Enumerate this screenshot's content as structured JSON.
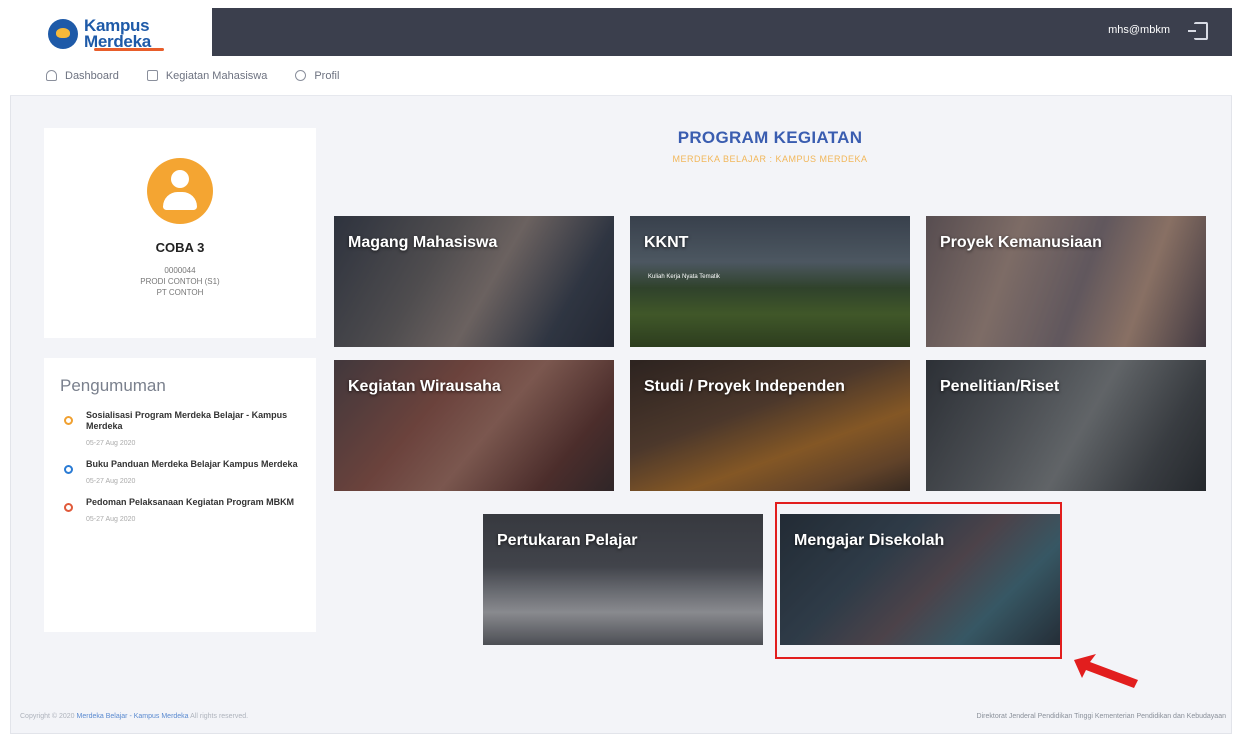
{
  "header": {
    "logo_line1": "Kampus",
    "logo_line2": "Merdeka",
    "user_email": "mhs@mbkm",
    "logout_icon": "logout-icon"
  },
  "nav": {
    "items": [
      {
        "label": "Dashboard",
        "icon": "home-icon"
      },
      {
        "label": "Kegiatan Mahasiswa",
        "icon": "document-icon"
      },
      {
        "label": "Profil",
        "icon": "user-icon"
      }
    ]
  },
  "profile": {
    "name": "COBA 3",
    "nim": "0000044",
    "prodi": "PRODI CONTOH (S1)",
    "pt": "PT CONTOH"
  },
  "announcements": {
    "title": "Pengumuman",
    "items": [
      {
        "title": "Sosialisasi Program Merdeka Belajar - Kampus Merdeka",
        "date": "05-27 Aug 2020"
      },
      {
        "title": "Buku Panduan Merdeka Belajar Kampus Merdeka",
        "date": "05-27 Aug 2020"
      },
      {
        "title": "Pedoman Pelaksanaan Kegiatan Program MBKM",
        "date": "05-27 Aug 2020"
      }
    ]
  },
  "main": {
    "title": "PROGRAM KEGIATAN",
    "subtitle": "MERDEKA BELAJAR : KAMPUS MERDEKA",
    "tiles": [
      {
        "label": "Magang Mahasiswa"
      },
      {
        "label": "KKNT",
        "sub": "Kuliah Kerja Nyata Tematik"
      },
      {
        "label": "Proyek Kemanusiaan"
      },
      {
        "label": "Kegiatan Wirausaha"
      },
      {
        "label": "Studi / Proyek Independen"
      },
      {
        "label": "Penelitian/Riset"
      },
      {
        "label": "Pertukaran Pelajar"
      },
      {
        "label": "Mengajar Disekolah"
      }
    ]
  },
  "footer": {
    "copyright_prefix": "Copyright © 2020",
    "copyright_link": "Merdeka Belajar - Kampus Merdeka",
    "copyright_suffix": "All rights reserved.",
    "right_text": "Direktorat Jenderal Pendidikan Tinggi Kementerian Pendidikan dan Kebudayaan"
  },
  "colors": {
    "topbar": "#3b3f4d",
    "accent_blue": "#3a5db0",
    "accent_orange": "#f4a532",
    "highlight": "#e21e1e"
  }
}
